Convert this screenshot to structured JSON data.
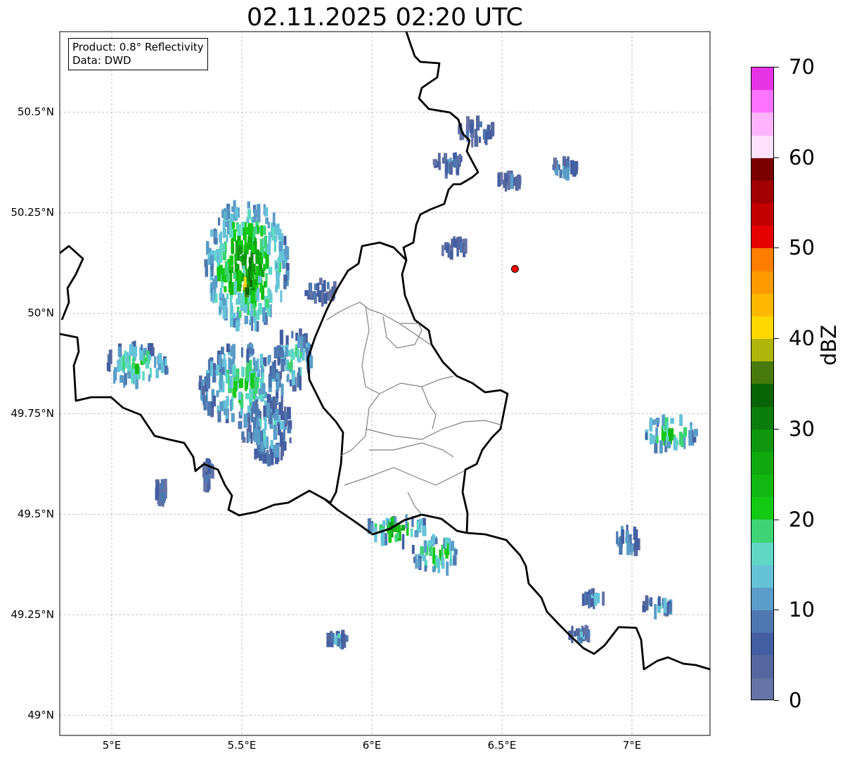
{
  "title": "02.11.2025 02:20 UTC",
  "info": {
    "product": "Product: 0.8° Reflectivity",
    "data": "Data: DWD"
  },
  "axes": {
    "lat_labels": [
      "49°N",
      "49.25°N",
      "49.5°N",
      "49.75°N",
      "50°N",
      "50.25°N",
      "50.5°N"
    ],
    "lon_labels": [
      "5°E",
      "5.5°E",
      "6°E",
      "6.5°E",
      "7°E"
    ]
  },
  "map_extent": {
    "lon_min": 4.8,
    "lon_max": 7.3,
    "lat_min": 48.95,
    "lat_max": 50.7
  },
  "radar_site": {
    "lon": 6.55,
    "lat": 50.11,
    "color": "#ff0000"
  },
  "colorbar": {
    "label": "dBZ",
    "min": 0,
    "max": 70,
    "step": 2.5,
    "tick_labels": [
      "0",
      "10",
      "20",
      "30",
      "40",
      "50",
      "60",
      "70"
    ],
    "colors": [
      "#6673a6",
      "#55679f",
      "#435ea1",
      "#4e79b0",
      "#5a9dc8",
      "#66c2d9",
      "#5fd7c5",
      "#3dd474",
      "#14c914",
      "#11b811",
      "#0fa80f",
      "#0e960e",
      "#0b7d0b",
      "#066306",
      "#477a0a",
      "#afb50a",
      "#ffd800",
      "#ffb800",
      "#ff9a00",
      "#ff7d00",
      "#e60000",
      "#c30000",
      "#a00000",
      "#7a0000",
      "#ffe0ff",
      "#ffb3ff",
      "#ff73ff",
      "#e633e6"
    ]
  },
  "echoes": [
    {
      "lon": 5.52,
      "lat": 50.12,
      "rx": 0.16,
      "ry": 0.16,
      "dbz": 28
    },
    {
      "lon": 5.52,
      "lat": 50.07,
      "rx": 0.06,
      "ry": 0.04,
      "dbz": 40
    },
    {
      "lon": 5.1,
      "lat": 49.87,
      "rx": 0.12,
      "ry": 0.05,
      "dbz": 22
    },
    {
      "lon": 5.5,
      "lat": 49.82,
      "rx": 0.16,
      "ry": 0.1,
      "dbz": 20
    },
    {
      "lon": 5.6,
      "lat": 49.71,
      "rx": 0.1,
      "ry": 0.08,
      "dbz": 14
    },
    {
      "lon": 5.7,
      "lat": 49.89,
      "rx": 0.07,
      "ry": 0.07,
      "dbz": 18
    },
    {
      "lon": 5.8,
      "lat": 50.06,
      "rx": 0.06,
      "ry": 0.03,
      "dbz": 8
    },
    {
      "lon": 7.15,
      "lat": 49.7,
      "rx": 0.1,
      "ry": 0.04,
      "dbz": 24
    },
    {
      "lon": 6.1,
      "lat": 49.46,
      "rx": 0.12,
      "ry": 0.03,
      "dbz": 26
    },
    {
      "lon": 6.25,
      "lat": 49.4,
      "rx": 0.1,
      "ry": 0.04,
      "dbz": 24
    },
    {
      "lon": 6.4,
      "lat": 50.45,
      "rx": 0.07,
      "ry": 0.025,
      "dbz": 10
    },
    {
      "lon": 6.3,
      "lat": 50.37,
      "rx": 0.06,
      "ry": 0.02,
      "dbz": 9
    },
    {
      "lon": 6.74,
      "lat": 50.36,
      "rx": 0.05,
      "ry": 0.02,
      "dbz": 14
    },
    {
      "lon": 6.32,
      "lat": 50.16,
      "rx": 0.05,
      "ry": 0.02,
      "dbz": 8
    },
    {
      "lon": 6.53,
      "lat": 50.33,
      "rx": 0.05,
      "ry": 0.01,
      "dbz": 7
    },
    {
      "lon": 6.98,
      "lat": 49.43,
      "rx": 0.05,
      "ry": 0.03,
      "dbz": 16
    },
    {
      "lon": 7.1,
      "lat": 49.27,
      "rx": 0.06,
      "ry": 0.015,
      "dbz": 16
    },
    {
      "lon": 6.85,
      "lat": 49.29,
      "rx": 0.04,
      "ry": 0.01,
      "dbz": 14
    },
    {
      "lon": 5.87,
      "lat": 49.19,
      "rx": 0.04,
      "ry": 0.01,
      "dbz": 14
    },
    {
      "lon": 5.19,
      "lat": 49.56,
      "rx": 0.02,
      "ry": 0.03,
      "dbz": 8
    },
    {
      "lon": 5.37,
      "lat": 49.6,
      "rx": 0.02,
      "ry": 0.03,
      "dbz": 9
    },
    {
      "lon": 6.8,
      "lat": 49.2,
      "rx": 0.04,
      "ry": 0.01,
      "dbz": 12
    }
  ]
}
